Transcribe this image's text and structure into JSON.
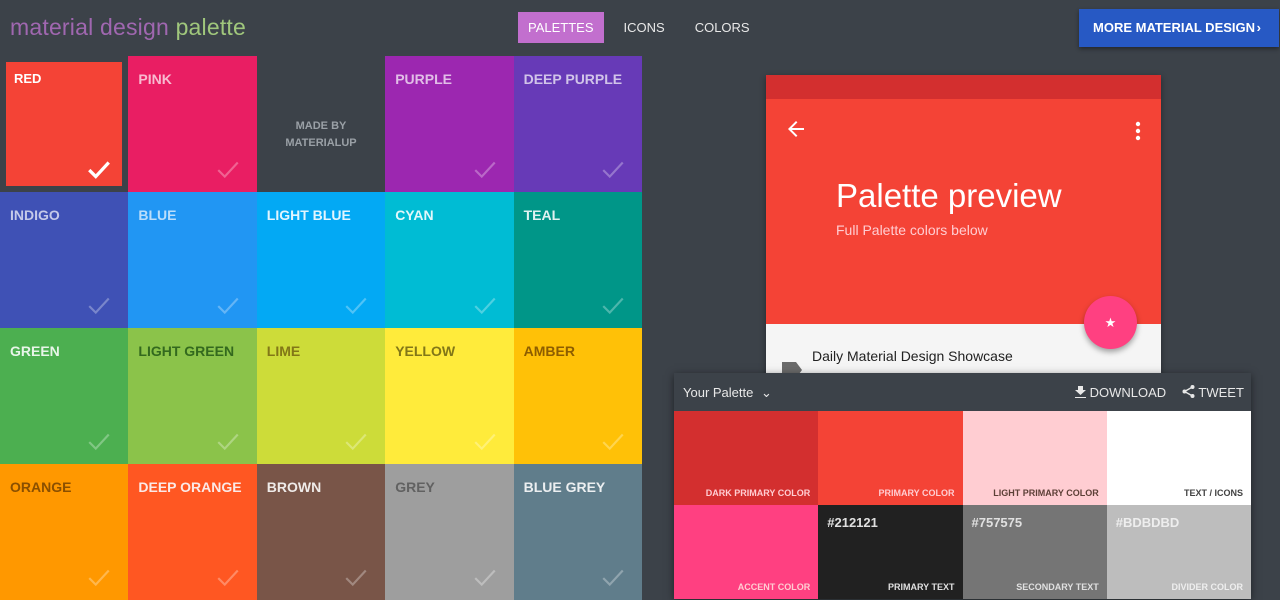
{
  "header": {
    "logo_part1": "material design",
    "logo_part2": "palette",
    "nav": [
      {
        "label": "PALETTES",
        "active": true
      },
      {
        "label": "ICONS",
        "active": false
      },
      {
        "label": "COLORS",
        "active": false
      }
    ],
    "more_button": "MORE MATERIAL DESIGN",
    "more_chevron": "›"
  },
  "grid": {
    "made_by_line1": "MADE BY",
    "made_by_line2": "MATERIALUP",
    "tiles": [
      {
        "name": "RED",
        "color": "#f44336",
        "text": "#ffffff",
        "check": "#ffffff",
        "selected": true
      },
      {
        "name": "PINK",
        "color": "#e91e63",
        "text": "#f8bbd0",
        "check": "#f06292"
      },
      {
        "name": "",
        "color": "#3c4249",
        "made_by": true
      },
      {
        "name": "PURPLE",
        "color": "#9c27b0",
        "text": "#e1bee7",
        "check": "#ba68c8"
      },
      {
        "name": "DEEP PURPLE",
        "color": "#673ab7",
        "text": "#d1c4e9",
        "check": "#9575cd"
      },
      {
        "name": "INDIGO",
        "color": "#3f51b5",
        "text": "#c5cae9",
        "check": "#7986cb"
      },
      {
        "name": "BLUE",
        "color": "#2196f3",
        "text": "#bbdefb",
        "check": "#64b5f6"
      },
      {
        "name": "LIGHT BLUE",
        "color": "#03a9f4",
        "text": "#e1f5fe",
        "check": "#4fc3f7"
      },
      {
        "name": "CYAN",
        "color": "#00bcd4",
        "text": "#e0f7fa",
        "check": "#4dd0e1"
      },
      {
        "name": "TEAL",
        "color": "#009688",
        "text": "#e0f2f1",
        "check": "#4db6ac"
      },
      {
        "name": "GREEN",
        "color": "#4caf50",
        "text": "#e8f5e9",
        "check": "#81c784"
      },
      {
        "name": "LIGHT GREEN",
        "color": "#8bc34a",
        "text": "#33691e",
        "check": "#aed581"
      },
      {
        "name": "LIME",
        "color": "#cddc39",
        "text": "#827717",
        "check": "#dce775"
      },
      {
        "name": "YELLOW",
        "color": "#ffeb3b",
        "text": "#827717",
        "check": "#fff176"
      },
      {
        "name": "AMBER",
        "color": "#ffc107",
        "text": "#8d5d00",
        "check": "#ffd54f"
      },
      {
        "name": "ORANGE",
        "color": "#ff9800",
        "text": "#8a4f00",
        "check": "#ffb74d"
      },
      {
        "name": "DEEP ORANGE",
        "color": "#ff5722",
        "text": "#fbe9e7",
        "check": "#ff8a65"
      },
      {
        "name": "BROWN",
        "color": "#795548",
        "text": "#efebe9",
        "check": "#a1887f"
      },
      {
        "name": "GREY",
        "color": "#9e9e9e",
        "text": "#616161",
        "check": "#bdbdbd"
      },
      {
        "name": "BLUE GREY",
        "color": "#607d8b",
        "text": "#eceff1",
        "check": "#90a4ae"
      }
    ]
  },
  "preview": {
    "title": "Palette preview",
    "subtitle": "Full Palette colors below",
    "list_item": "Daily Material Design Showcase",
    "fab_icon": "★"
  },
  "palette": {
    "title": "Your Palette",
    "title_chevron": "⌄",
    "download": "DOWNLOAD",
    "tweet": "TWEET",
    "swatches": [
      {
        "label": "DARK PRIMARY COLOR",
        "color": "#d32f2f",
        "text": "#ffcdd2",
        "hex": ""
      },
      {
        "label": "PRIMARY COLOR",
        "color": "#f44336",
        "text": "#ffcdd2",
        "hex": ""
      },
      {
        "label": "LIGHT PRIMARY COLOR",
        "color": "#ffcdd2",
        "text": "#5d4037",
        "hex": ""
      },
      {
        "label": "TEXT / ICONS",
        "color": "#ffffff",
        "text": "#424242",
        "hex": ""
      },
      {
        "label": "ACCENT COLOR",
        "color": "#ff4081",
        "text": "#ffcdd2",
        "hex": ""
      },
      {
        "label": "PRIMARY TEXT",
        "color": "#212121",
        "text": "#e0e0e0",
        "hex": "#212121"
      },
      {
        "label": "SECONDARY TEXT",
        "color": "#757575",
        "text": "#e0e0e0",
        "hex": "#757575"
      },
      {
        "label": "DIVIDER COLOR",
        "color": "#bdbdbd",
        "text": "#eeeeee",
        "hex": "#BDBDBD"
      }
    ]
  }
}
